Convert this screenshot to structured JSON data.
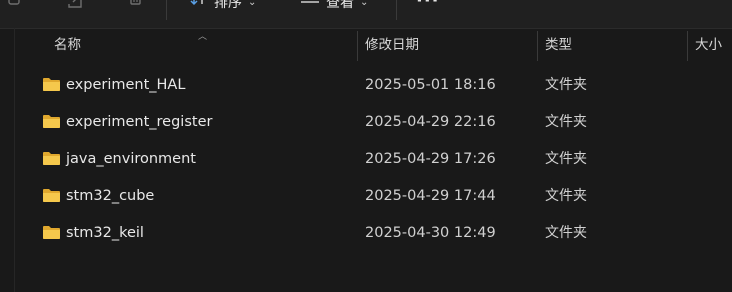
{
  "toolbar": {
    "copy_icon": "copy-icon",
    "share_icon": "share-icon",
    "delete_icon": "delete-icon",
    "sort_label": "排序",
    "view_label": "查看",
    "more_label": "···"
  },
  "columns": {
    "name": "名称",
    "date_modified": "修改日期",
    "type": "类型",
    "size": "大小"
  },
  "files": [
    {
      "name": "experiment_HAL",
      "date": "2025-05-01 18:16",
      "type": "文件夹"
    },
    {
      "name": "experiment_register",
      "date": "2025-04-29 22:16",
      "type": "文件夹"
    },
    {
      "name": "java_environment",
      "date": "2025-04-29 17:26",
      "type": "文件夹"
    },
    {
      "name": "stm32_cube",
      "date": "2025-04-29 17:44",
      "type": "文件夹"
    },
    {
      "name": "stm32_keil",
      "date": "2025-04-30 12:49",
      "type": "文件夹"
    }
  ],
  "colors": {
    "background": "#191919",
    "folder": "#f2c14e",
    "folder_dark": "#e0a82e",
    "text": "#e8e8e8"
  }
}
